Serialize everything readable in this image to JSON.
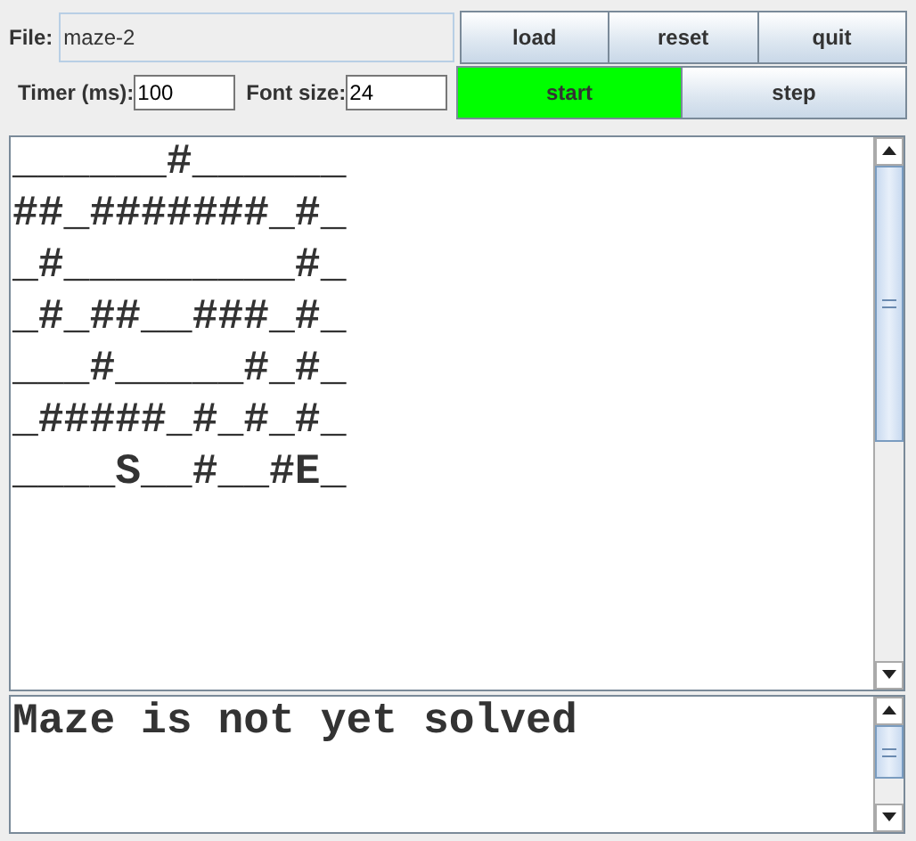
{
  "file": {
    "label": "File:",
    "value": "maze-2"
  },
  "top_buttons": [
    {
      "label": "load",
      "highlighted": false
    },
    {
      "label": "reset",
      "highlighted": false
    },
    {
      "label": "quit",
      "highlighted": false
    }
  ],
  "timer": {
    "label": "Timer (ms):",
    "value": "100"
  },
  "font_size": {
    "label": "Font size:",
    "value": "24"
  },
  "run_buttons": [
    {
      "label": "start",
      "highlighted": true
    },
    {
      "label": "step",
      "highlighted": false
    }
  ],
  "maze_lines": [
    "______#______",
    "##_#######_#_",
    "_#_________#_",
    "_#_##__###_#_",
    "___#_____#_#_",
    "_#####_#_#_#_",
    "____S__#__#E_"
  ],
  "status": "Maze is not yet solved"
}
